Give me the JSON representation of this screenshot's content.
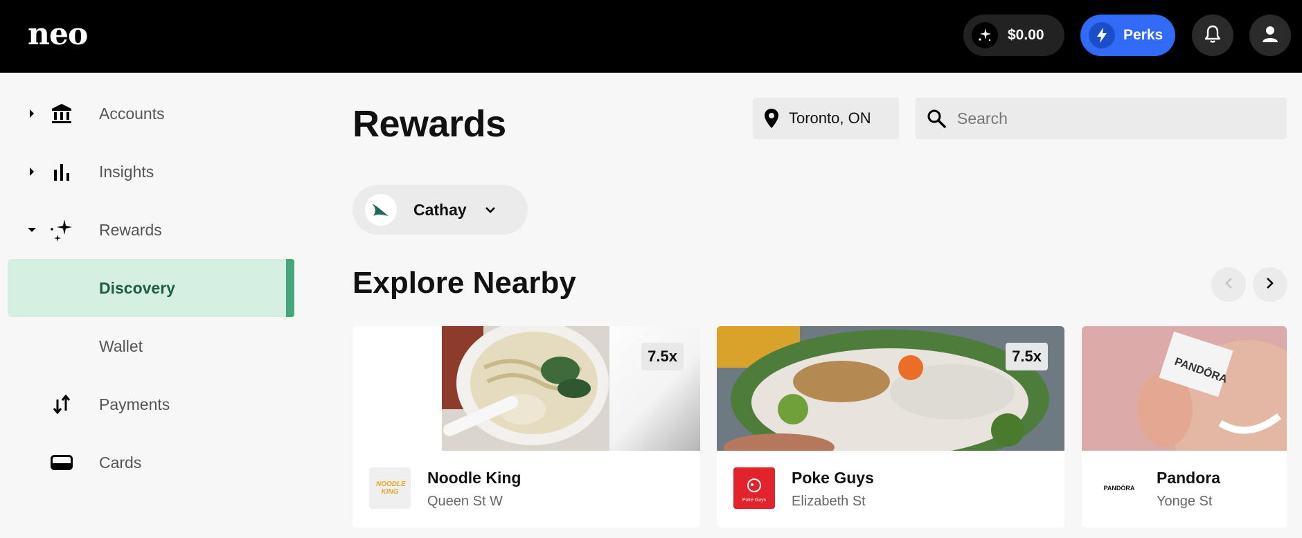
{
  "header": {
    "logo_text": "neo",
    "balance": "$0.00",
    "perks_label": "Perks",
    "accent_color": "#2f6bf6"
  },
  "sidebar": {
    "items": [
      {
        "label": "Accounts",
        "icon": "bank-icon",
        "expandable": true
      },
      {
        "label": "Insights",
        "icon": "bar-chart-icon",
        "expandable": true
      },
      {
        "label": "Rewards",
        "icon": "sparkle-icon",
        "expandable": true,
        "expanded": true
      },
      {
        "label": "Discovery",
        "active": true
      },
      {
        "label": "Wallet"
      },
      {
        "label": "Payments",
        "icon": "transfer-arrows-icon"
      },
      {
        "label": "Cards",
        "icon": "card-icon"
      }
    ],
    "active_color": "#43a77b"
  },
  "main": {
    "title": "Rewards",
    "location": "Toronto, ON",
    "search_placeholder": "Search",
    "program": "Cathay",
    "section_title": "Explore Nearby",
    "cards": [
      {
        "name": "Noodle King",
        "street": "Queen St W",
        "multiplier": "7.5x",
        "logo_text": "NOODLE KING"
      },
      {
        "name": "Poke Guys",
        "street": "Elizabeth St",
        "multiplier": "7.5x",
        "logo_text": "Poke Guys"
      },
      {
        "name": "Pandora",
        "street": "Yonge St",
        "logo_text": "PANDŌRA",
        "image_text": "PANDŌRA"
      }
    ]
  }
}
